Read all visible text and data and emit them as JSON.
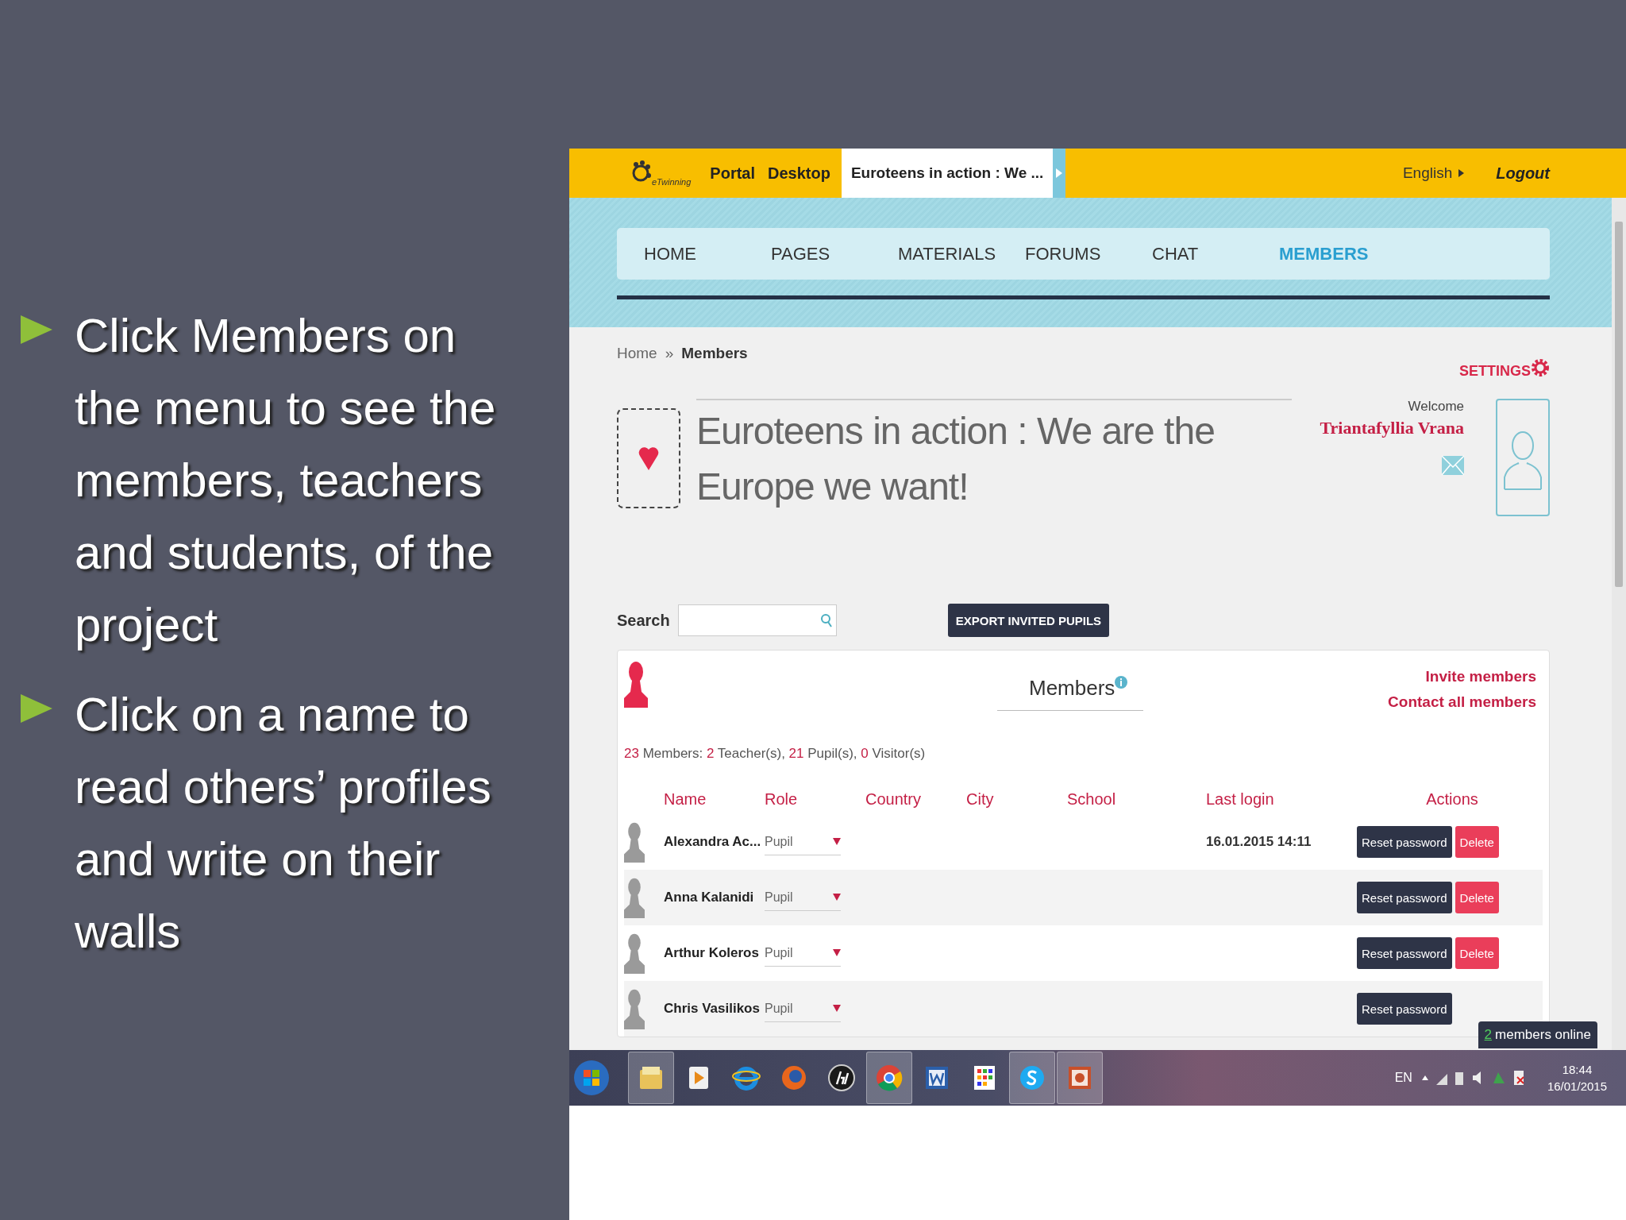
{
  "slide": {
    "bullets": [
      "Click Members on the menu to see the members, teachers and students, of the project",
      "Click on a name to read others’ profiles and write on their walls"
    ]
  },
  "topbar": {
    "logo_text": "eTwinning",
    "links": [
      "Portal",
      "Desktop"
    ],
    "project_tab": "Euroteens in action : We ...",
    "language": "English",
    "logout": "Logout"
  },
  "nav": [
    {
      "label": "HOME",
      "selected": false
    },
    {
      "label": "PAGES",
      "selected": false
    },
    {
      "label": "MATERIALS",
      "selected": false
    },
    {
      "label": "FORUMS",
      "selected": false
    },
    {
      "label": "CHAT",
      "selected": false
    },
    {
      "label": "MEMBERS",
      "selected": true
    }
  ],
  "breadcrumb": {
    "home": "Home",
    "separator": "»",
    "current": "Members"
  },
  "settings": "SETTINGS",
  "project_title": "Euroteens in action : We are the Europe we want!",
  "welcome": {
    "label": "Welcome",
    "user": "Triantafyllia Vrana"
  },
  "search": {
    "label": "Search"
  },
  "export_button": "EXPORT INVITED PUPILS",
  "members": {
    "title": "Members",
    "links": [
      "Invite members",
      "Contact all members"
    ],
    "summary": [
      {
        "text": "23",
        "accent": true
      },
      {
        "text": " Members: ",
        "accent": false
      },
      {
        "text": "2",
        "accent": true
      },
      {
        "text": " Teacher(s), ",
        "accent": false
      },
      {
        "text": "21",
        "accent": true
      },
      {
        "text": " Pupil(s), ",
        "accent": false
      },
      {
        "text": "0",
        "accent": true
      },
      {
        "text": " Visitor(s)",
        "accent": false
      }
    ],
    "columns": [
      "Name",
      "Role",
      "Country",
      "City",
      "School",
      "Last login",
      "Actions"
    ],
    "rows": [
      {
        "name": "Alexandra Ac...",
        "role": "Pupil",
        "last_login": "16.01.2015 14:11",
        "actions": [
          "Reset password",
          "Delete"
        ]
      },
      {
        "name": "Anna Kalanidi",
        "role": "Pupil",
        "actions": [
          "Reset password",
          "Delete"
        ]
      },
      {
        "name": "Arthur Koleros",
        "role": "Pupil",
        "actions": [
          "Reset password",
          "Delete"
        ]
      },
      {
        "name": "Chris Vasilikos",
        "role": "Pupil",
        "actions": [
          "Reset password"
        ]
      }
    ]
  },
  "online": {
    "count": "2",
    "text": "members online"
  },
  "taskbar": {
    "apps": [
      {
        "kind": "folder",
        "selected": true
      },
      {
        "kind": "player",
        "selected": false
      },
      {
        "kind": "ie",
        "selected": false
      },
      {
        "kind": "firefox",
        "selected": false
      },
      {
        "kind": "hp",
        "selected": false
      },
      {
        "kind": "chrome",
        "selected": true
      },
      {
        "kind": "word",
        "selected": false
      },
      {
        "kind": "grid",
        "selected": false
      },
      {
        "kind": "skype",
        "selected": true
      },
      {
        "kind": "powerpoint",
        "selected": true
      }
    ],
    "language": "EN",
    "time": "18:44",
    "date": "16/01/2015"
  }
}
